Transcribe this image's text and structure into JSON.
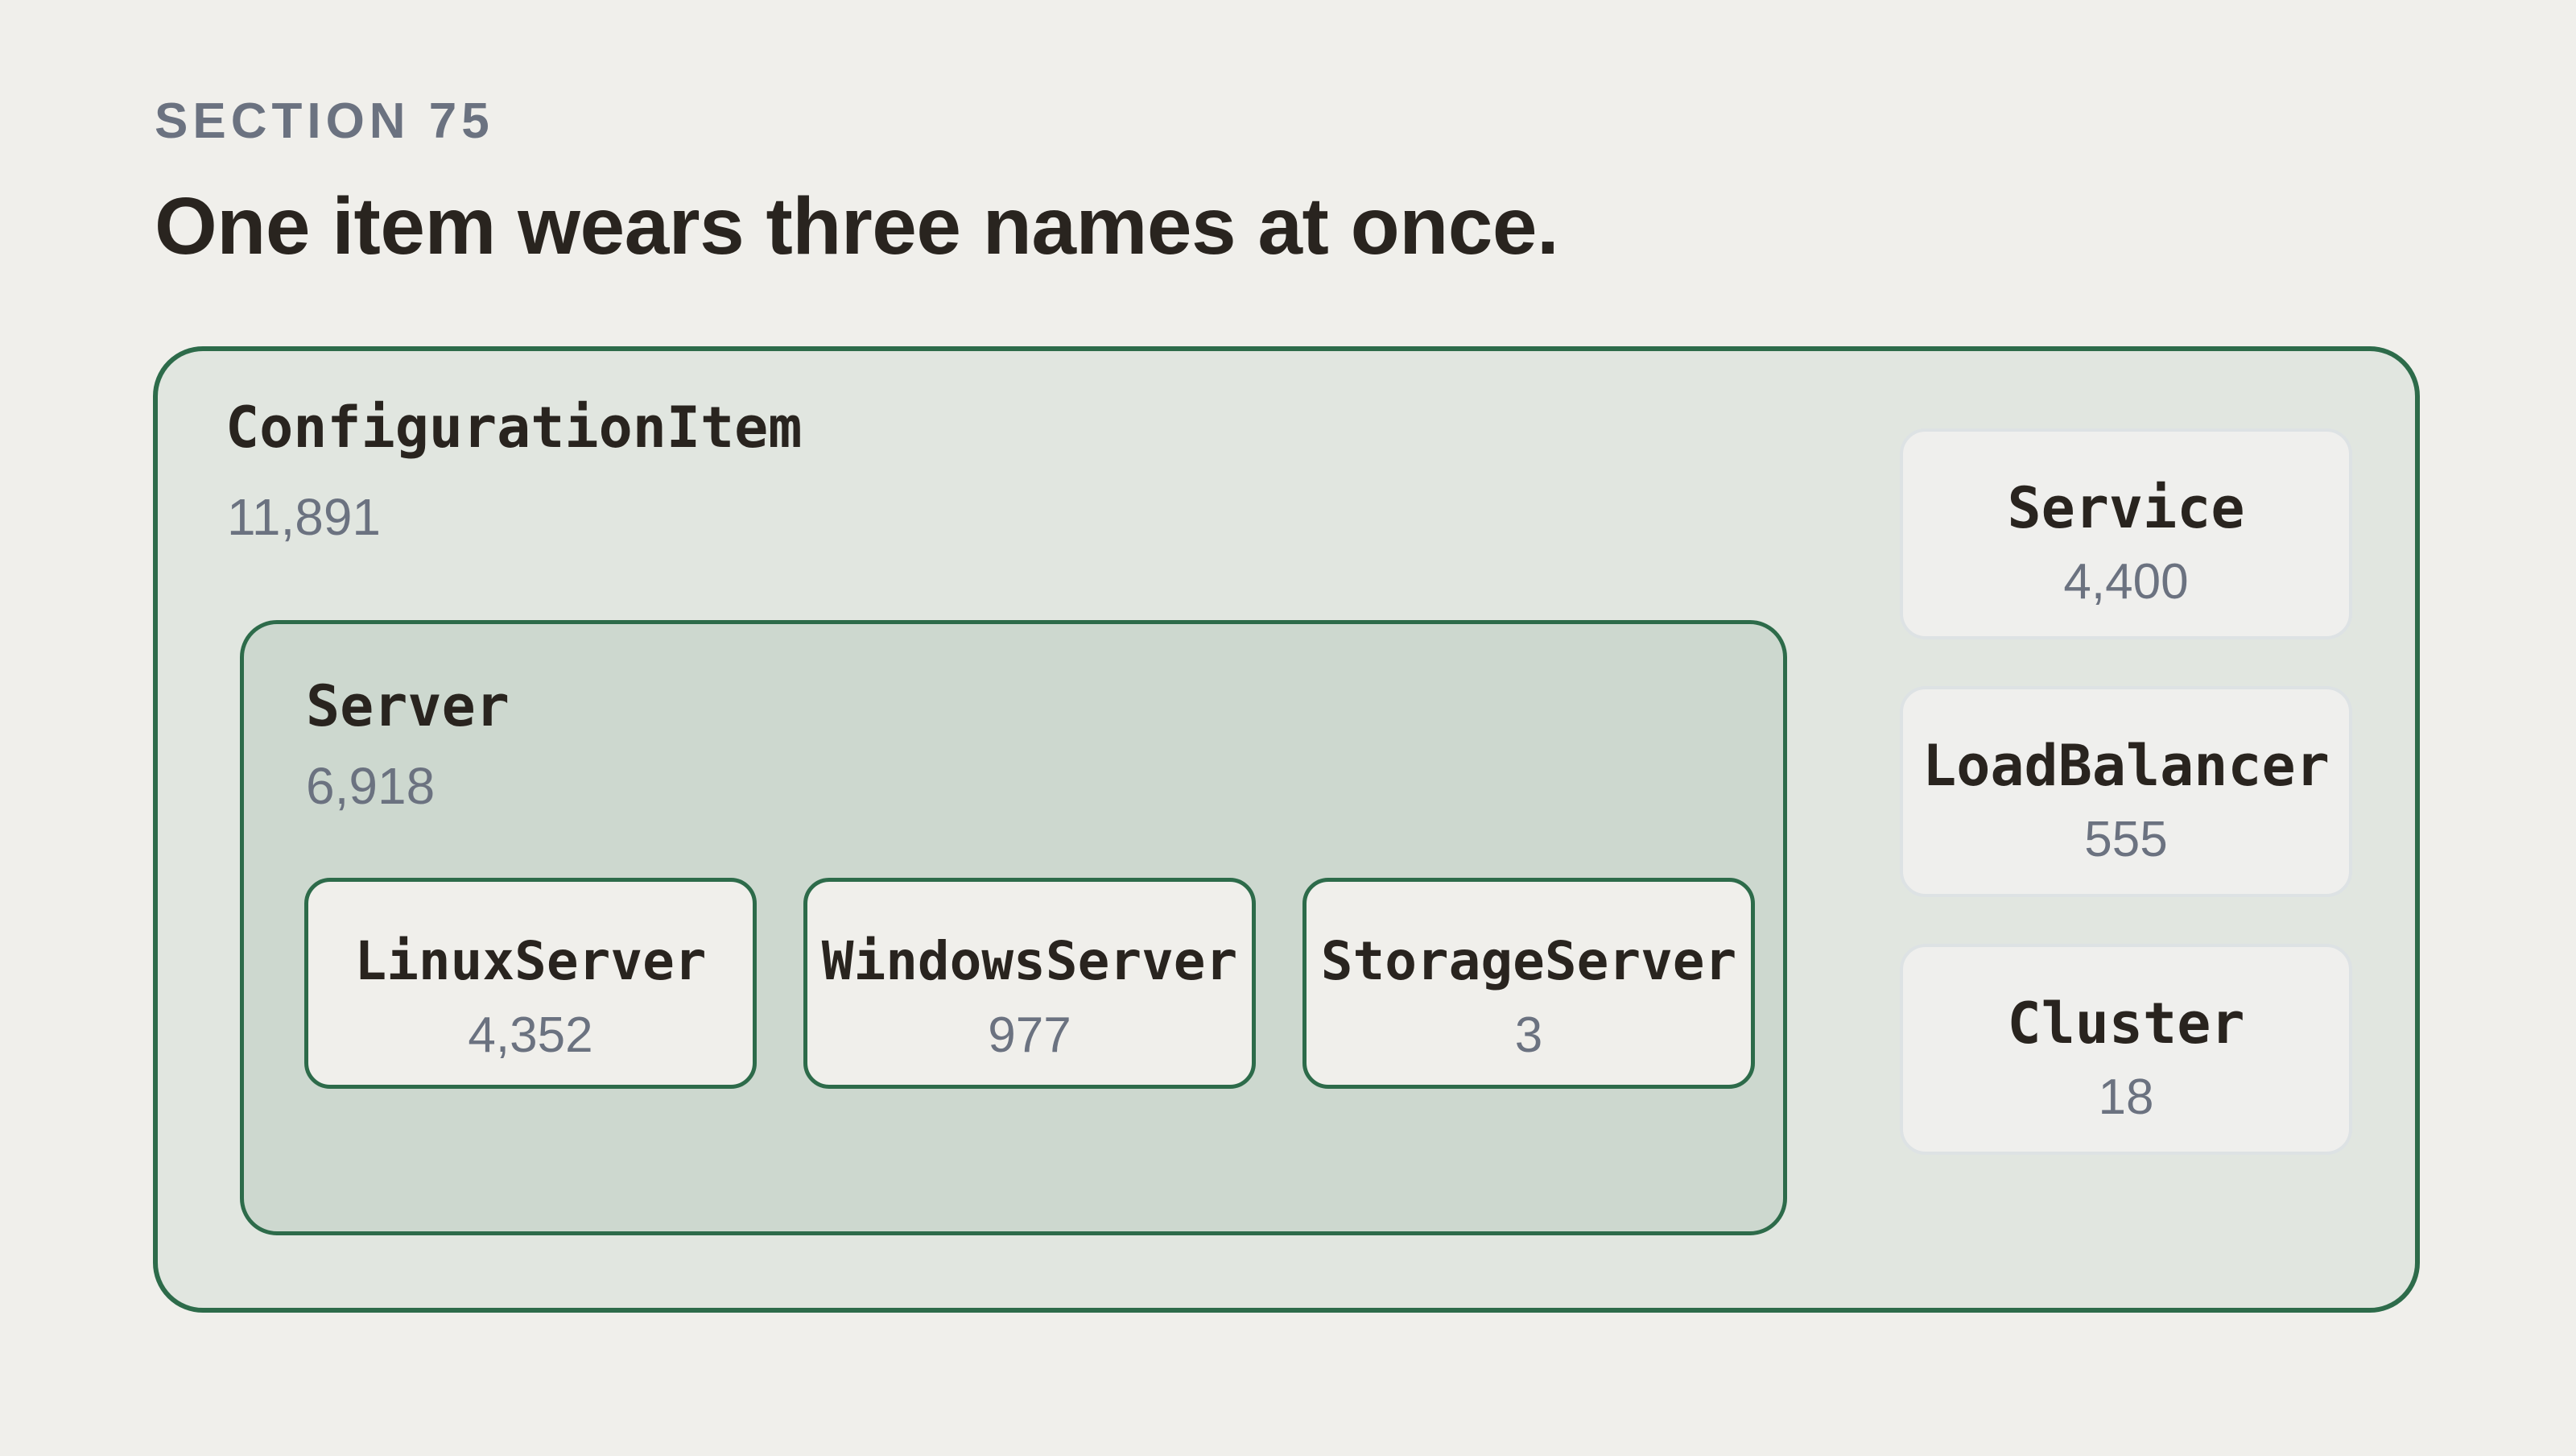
{
  "header": {
    "eyebrow": "SECTION 75",
    "title": "One item wears three names at once."
  },
  "diagram": {
    "root": {
      "name": "ConfigurationItem",
      "count": "11,891"
    },
    "server": {
      "name": "Server",
      "count": "6,918",
      "children": [
        {
          "name": "LinuxServer",
          "count": "4,352"
        },
        {
          "name": "WindowsServer",
          "count": "977"
        },
        {
          "name": "StorageServer",
          "count": "3"
        }
      ]
    },
    "siblings": [
      {
        "name": "Service",
        "count": "4,400"
      },
      {
        "name": "LoadBalancer",
        "count": "555"
      },
      {
        "name": "Cluster",
        "count": "18"
      }
    ]
  },
  "colors": {
    "accent_border": "#2d6b4a",
    "outer_fill": "#e1e6e0",
    "server_fill": "#cdd8cf",
    "background": "#f0efeb",
    "muted_text": "#6b7280",
    "dark_text": "#29241f"
  }
}
